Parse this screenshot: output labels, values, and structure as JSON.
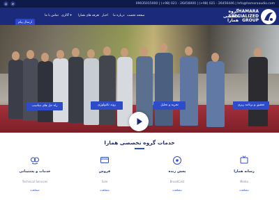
{
  "topbar": {
    "contact": "09035015000 | (+98) 021 - 26456000 | (+98) 021 - 26456446 | Info@hamaraaudio.com"
  },
  "navbar": {
    "brand_fa": "گروه تخصصی همارا",
    "brand_en_1": "HAMARA",
    "brand_en_2": "SPECIALIZED",
    "brand_en_3": "GROUP",
    "menu": [
      "صفحه نخست",
      "درباره ما",
      "اخبار",
      "تعرفه های همارا",
      "گالری",
      "تماس با ما"
    ],
    "send_button": "ارسال پیام"
  },
  "hero": {
    "captions": [
      "تحقیق و برنامه ریزی",
      "تجزیه و تحلیل",
      "روند تکنولوژی",
      "راه حل های مناسب"
    ],
    "accent": "#2e4bc9"
  },
  "services": {
    "title": "خدمات گروه تخصصی همارا",
    "items": [
      {
        "title": "رسانه همارا",
        "sub": "Media",
        "more": "مشاهده",
        "icon": "media-icon"
      },
      {
        "title": "پخش زنده",
        "sub": "BroadCast",
        "more": "مشاهده",
        "icon": "broadcast-icon"
      },
      {
        "title": "فروش",
        "sub": "Sale",
        "more": "مشاهده",
        "icon": "sale-icon"
      },
      {
        "title": "خدمات و پشتیبانی",
        "sub": "Technical Services",
        "more": "مشاهده",
        "icon": "support-icon"
      }
    ]
  },
  "colors": {
    "navy": "#1b2a7a",
    "dark_navy": "#0e1a4a",
    "blue": "#2e4bc9"
  }
}
